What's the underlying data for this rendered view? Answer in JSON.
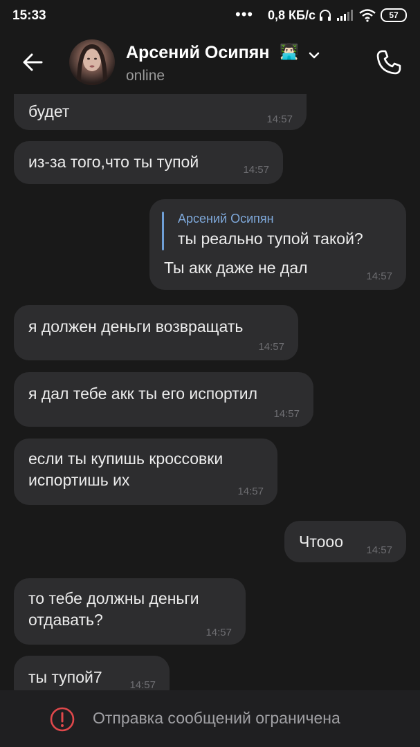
{
  "status_bar": {
    "time": "15:33",
    "dots": "•••",
    "speed": "0,8 КБ/с",
    "battery": "57"
  },
  "header": {
    "name": "Арсений Осипян",
    "emoji": "👨🏻‍💻",
    "presence": "online"
  },
  "messages": [
    {
      "side": "in",
      "text": "будет",
      "time": "14:57"
    },
    {
      "side": "in",
      "text": "из-за того,что ты тупой",
      "time": "14:57"
    },
    {
      "side": "out",
      "reply_name": "Арсений Осипян",
      "reply_text": "ты реально тупой такой?",
      "text": "Ты акк даже не дал",
      "time": "14:57"
    },
    {
      "side": "in",
      "text": "я должен деньги возвращать",
      "time": "14:57"
    },
    {
      "side": "in",
      "text": "я дал тебе акк ты его испортил",
      "time": "14:57"
    },
    {
      "side": "in",
      "text": "если ты купишь кроссовки\nиспортишь их",
      "time": "14:57"
    },
    {
      "side": "out",
      "text": "Чтооо",
      "time": "14:57"
    },
    {
      "side": "in",
      "text": "то тебе должны деньги\nотдавать?",
      "time": "14:57"
    },
    {
      "side": "in",
      "text": "ты тупой7",
      "time": "14:57"
    }
  ],
  "footer": {
    "notice": "Отправка сообщений ограничена"
  },
  "colors": {
    "background": "#191919",
    "bubble": "#2d2d2f",
    "accent": "#7fa9db",
    "warning": "#e0484b"
  },
  "icons": [
    "back-arrow-icon",
    "chevron-down-icon",
    "phone-icon",
    "warning-icon",
    "headphones-icon",
    "signal-icon",
    "wifi-icon",
    "battery-icon"
  ]
}
